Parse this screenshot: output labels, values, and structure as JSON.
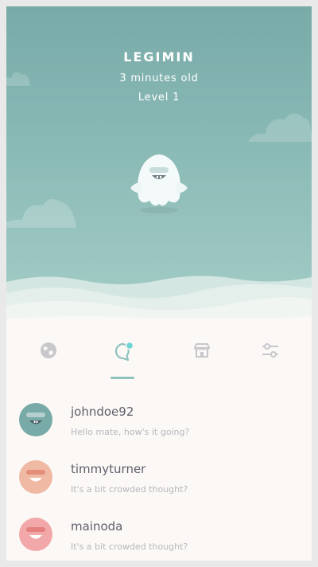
{
  "pet": {
    "name": "LEGIMIN",
    "age": "3 minutes old",
    "level": "Level 1"
  },
  "tabs": [
    {
      "icon": "globe-icon",
      "active": false
    },
    {
      "icon": "chat-bubble-icon",
      "active": true,
      "has_notification": true
    },
    {
      "icon": "shop-icon",
      "active": false
    },
    {
      "icon": "settings-sliders-icon",
      "active": false
    }
  ],
  "chats": [
    {
      "username": "johndoe92",
      "message": "Hello mate, how's it going?",
      "avatar_color": "#78aaa8"
    },
    {
      "username": "timmyturner",
      "message": "It's a bit crowded thought?",
      "avatar_color": "#f0b9a4"
    },
    {
      "username": "mainoda",
      "message": "It's a bit crowded thought?",
      "avatar_color": "#f2a8a8"
    }
  ],
  "colors": {
    "sky_top": "#78aaa8",
    "sky_bottom": "#a4ccc6",
    "accent": "#8fc2be",
    "notification_dot": "#6fd3d6",
    "background": "#fbf8f5"
  }
}
